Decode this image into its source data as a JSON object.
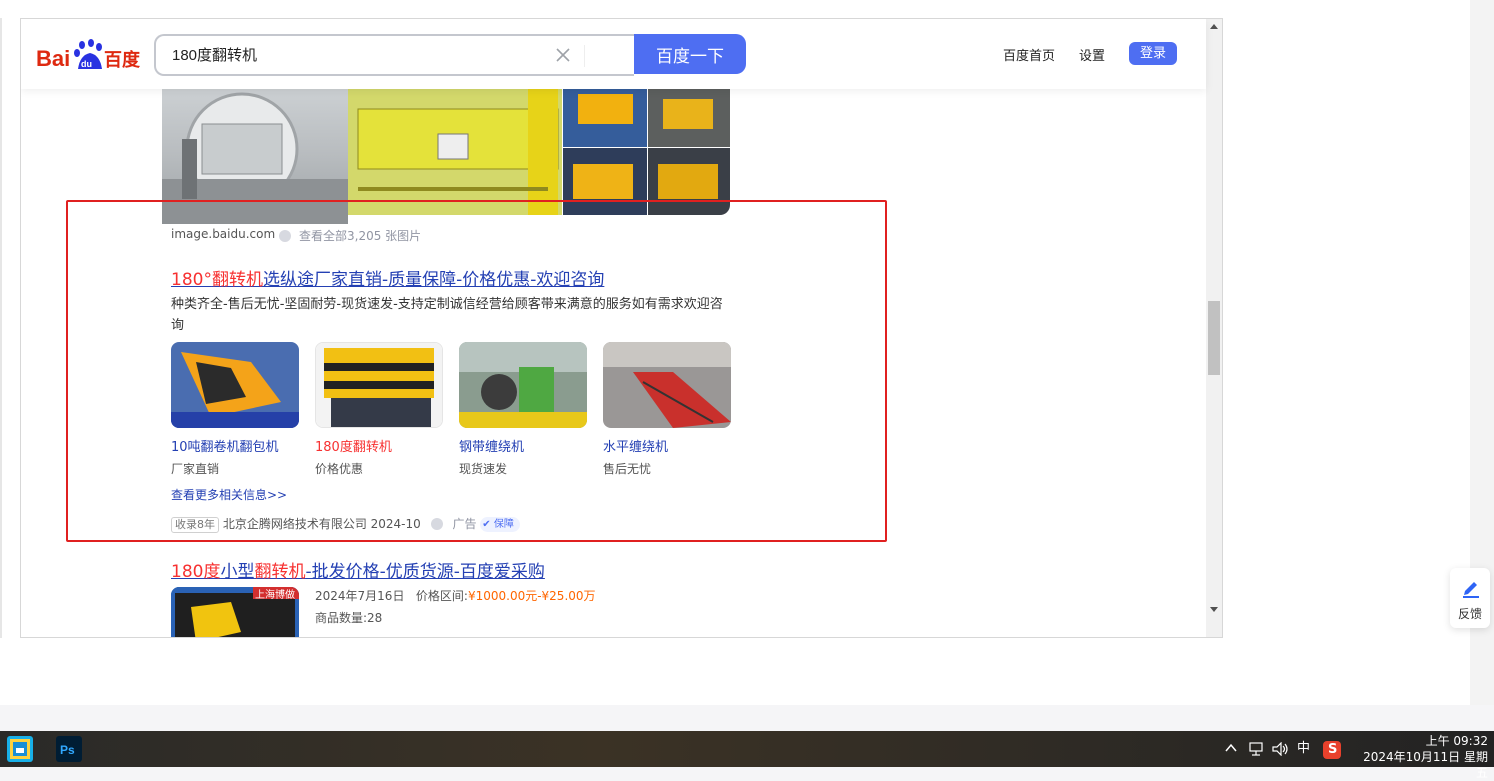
{
  "header": {
    "logo_text": "Bai百度",
    "search_value": "180度翻转机",
    "search_button": "百度一下",
    "nav_home": "百度首页",
    "nav_settings": "设置",
    "login": "登录"
  },
  "image_section": {
    "domain": "image.baidu.com",
    "see_all": "查看全部3,205 张图片"
  },
  "result1": {
    "title_red1": "180°",
    "title_red2": "翻转机",
    "title_rest": "选纵途厂家直销-质量保障-价格优惠-欢迎咨询",
    "desc": "种类齐全-售后无忧-坚固耐劳-现货速发-支持定制诚信经营给顾客带来满意的服务如有需求欢迎咨询",
    "cards": [
      {
        "title": "10吨翻卷机翻包机",
        "sub": "厂家直销"
      },
      {
        "title": "180度翻转机",
        "sub": "价格优惠"
      },
      {
        "title": "钢带缠绕机",
        "sub": "现货速发"
      },
      {
        "title": "水平缠绕机",
        "sub": "售后无忧"
      }
    ],
    "more": "查看更多相关信息>>",
    "years_badge": "收录8年",
    "company": "北京企腾网络技术有限公司 2024-10",
    "ad": "广告",
    "guarantee": "保障"
  },
  "result2": {
    "title_red1": "180度",
    "title_mid": "小型",
    "title_red2": "翻转机",
    "title_rest": "-批发价格-优质货源-百度爱采购",
    "thumb_tag": "上海博做",
    "date": "2024年7月16日",
    "price_label": "价格区间:",
    "price": "¥1000.00元-¥25.00万",
    "count": "商品数量:28"
  },
  "feedback": {
    "label": "反馈"
  },
  "taskbar": {
    "ime": "中",
    "time": "上午 09:32",
    "date": "2024年10月11日 星期五"
  },
  "colors": {
    "baidu_blue": "#4e6ef2",
    "link_blue": "#2440b3",
    "highlight_red": "#f73131",
    "annotation_red": "#e02020"
  }
}
